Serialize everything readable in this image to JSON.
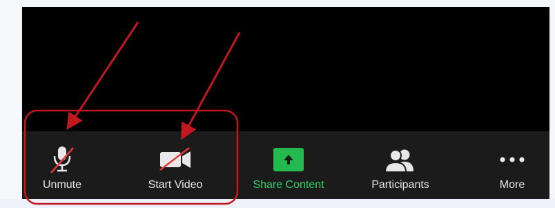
{
  "toolbar": {
    "unmute_label": "Unmute",
    "start_video_label": "Start Video",
    "share_label": "Share Content",
    "participants_label": "Participants",
    "more_label": "More"
  },
  "icons": {
    "unmute": "microphone-muted-icon",
    "start_video": "video-camera-off-icon",
    "share": "share-upload-icon",
    "participants": "participants-icon",
    "more": "more-dots-icon"
  },
  "colors": {
    "toolbar_bg": "#1b1b1b",
    "video_bg": "#000000",
    "share_green": "#23b94f",
    "annotation_red": "#c0181d",
    "mute_slash_red": "#e23a3a"
  }
}
